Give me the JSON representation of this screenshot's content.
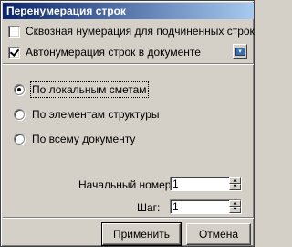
{
  "window": {
    "title": "Перенумерация строк"
  },
  "options": {
    "through_numbering": {
      "label": "Сквозная нумерация для подчиненных строк",
      "checked": false
    },
    "auto_numbering": {
      "label": "Автонумерация строк в документе",
      "checked": true
    }
  },
  "scope": {
    "selected": "local",
    "items": [
      {
        "label": "По локальным сметам",
        "checked": true
      },
      {
        "label": "По элементам структуры",
        "checked": false
      },
      {
        "label": "По всему документу",
        "checked": false
      }
    ]
  },
  "fields": {
    "start_label": "Начальный номер:",
    "start_value": "1",
    "step_label": "Шаг:",
    "step_value": "1"
  },
  "buttons": {
    "apply": "Применить",
    "cancel": "Отмена"
  },
  "icons": {
    "settings_button": "window-icon",
    "spin_up": "up-arrow-icon",
    "spin_down": "down-arrow-icon"
  }
}
